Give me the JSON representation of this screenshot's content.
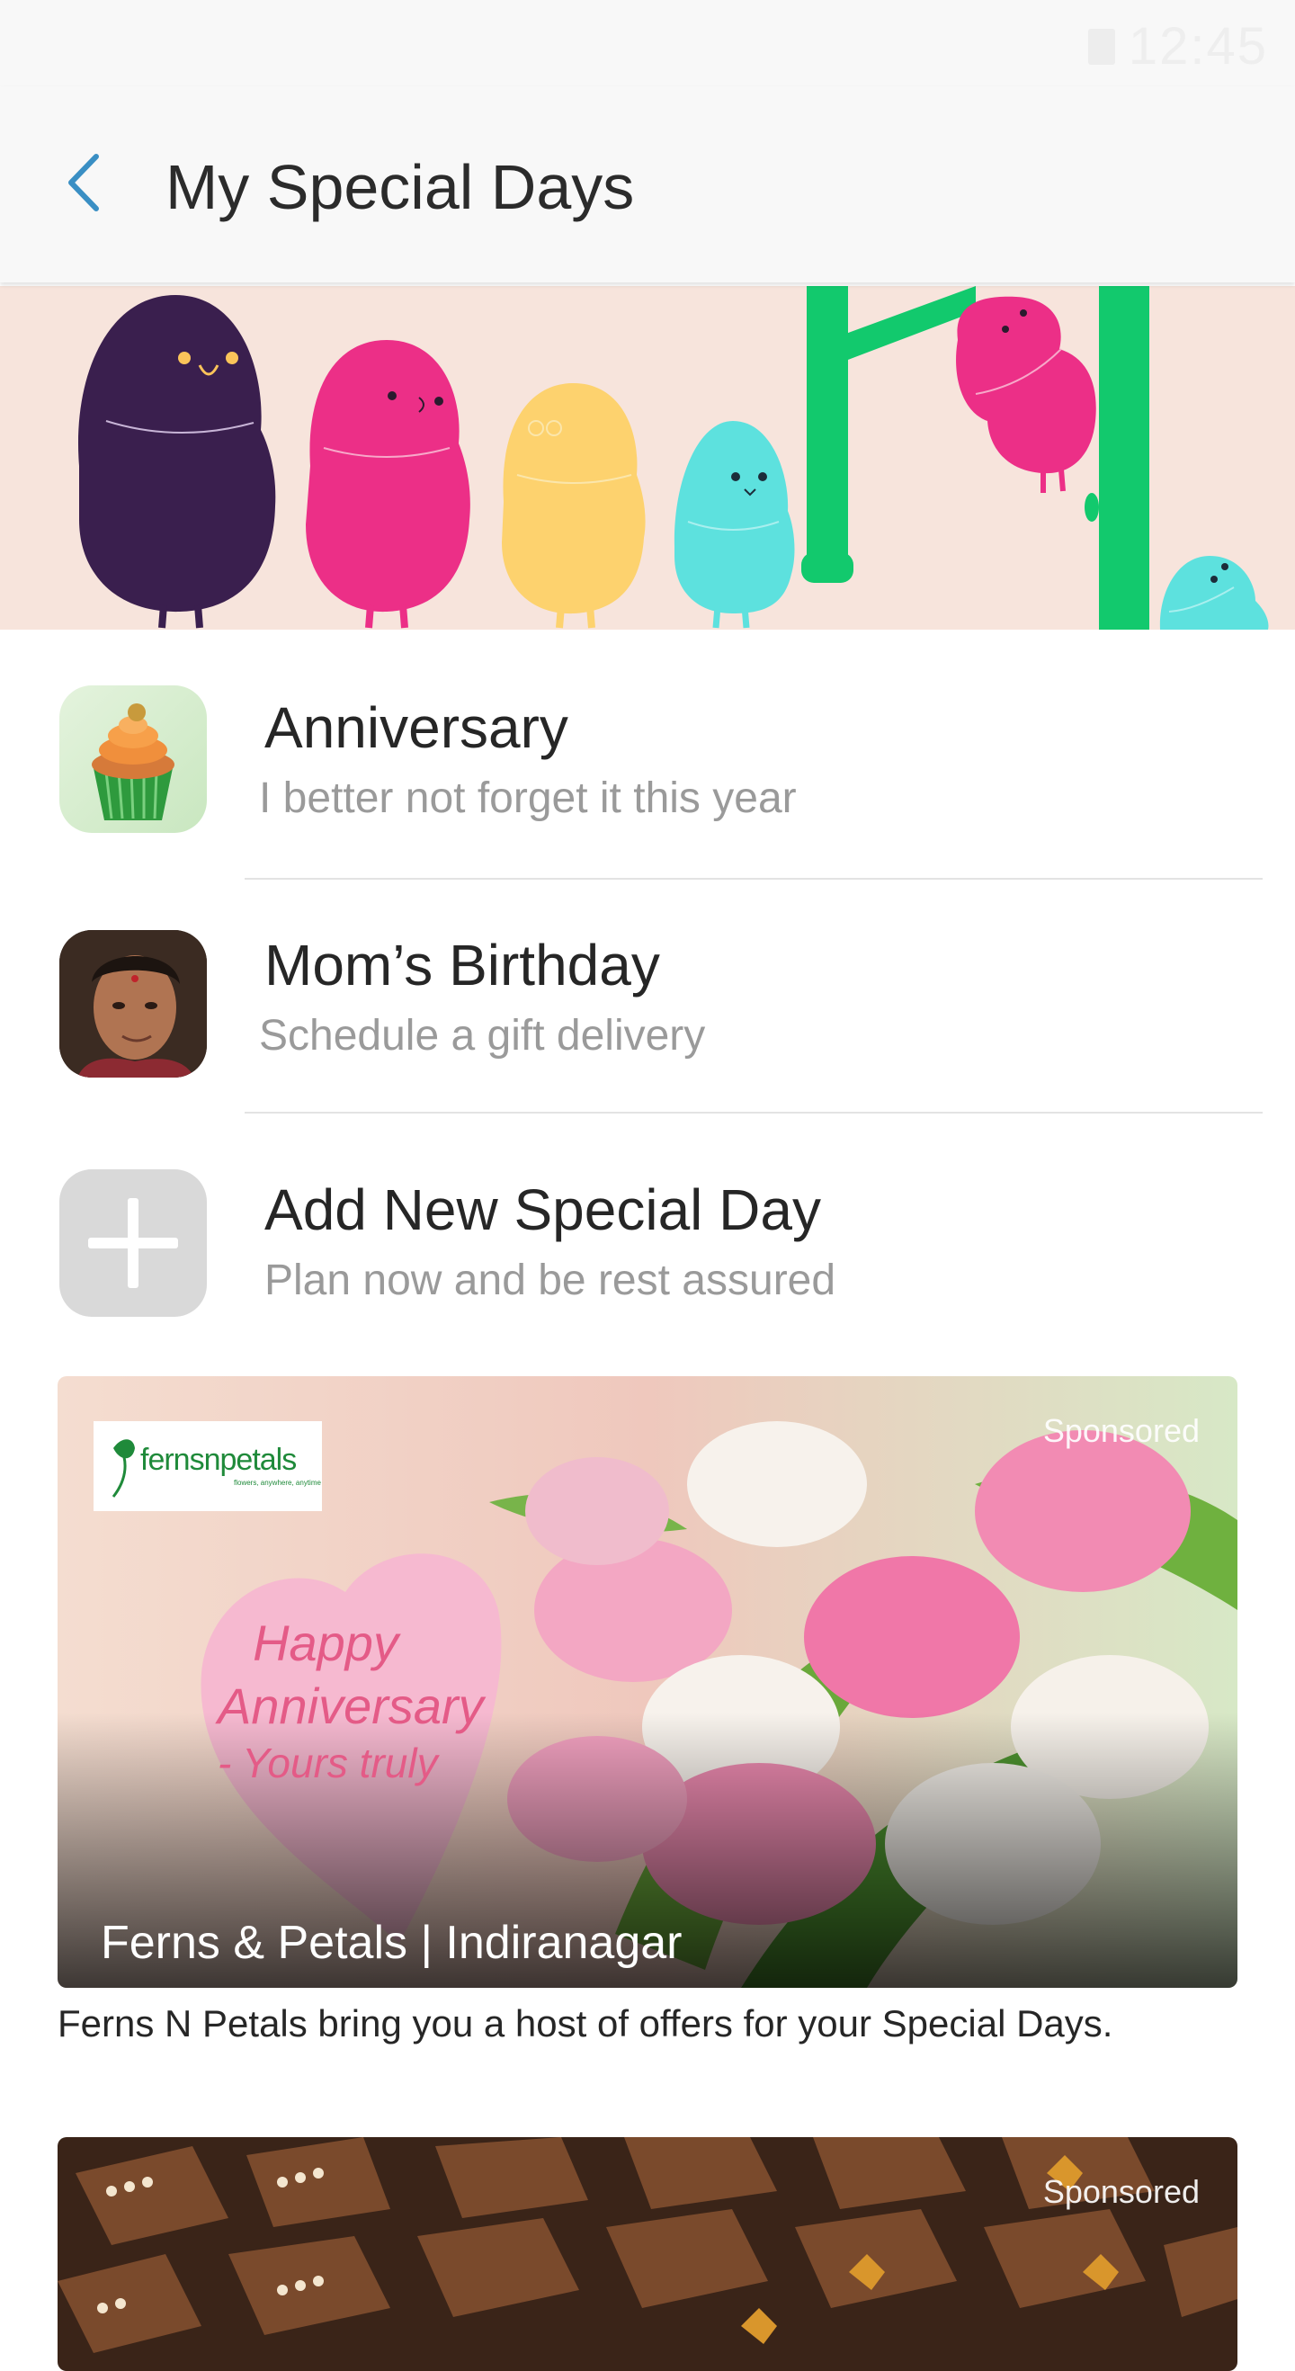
{
  "status_bar": {
    "time": "12:45"
  },
  "header": {
    "title": "My Special Days",
    "back_icon": "chevron-left-icon"
  },
  "colors": {
    "accent": "#3a8fc4",
    "hero_bg": "#f7e4dc"
  },
  "special_days": [
    {
      "title": "Anniversary",
      "subtitle": "I better not forget it this year",
      "icon": "cupcake-icon"
    },
    {
      "title": "Mom’s Birthday",
      "subtitle": "Schedule a gift delivery",
      "icon": "avatar"
    },
    {
      "title": "Add New Special Day",
      "subtitle": "Plan now and be rest assured",
      "icon": "plus-icon"
    }
  ],
  "ads": [
    {
      "sponsored": "Sponsored",
      "brand_logo": "fernsnpetals",
      "brand_tagline": "flowers, anywhere, anytime",
      "heart_line1": "Happy",
      "heart_line2": "Anniversary",
      "heart_line3": "- Yours truly",
      "caption": "Ferns & Petals | Indiranagar",
      "description": "Ferns N Petals bring you a host of offers for your Special Days."
    },
    {
      "sponsored": "Sponsored"
    }
  ]
}
